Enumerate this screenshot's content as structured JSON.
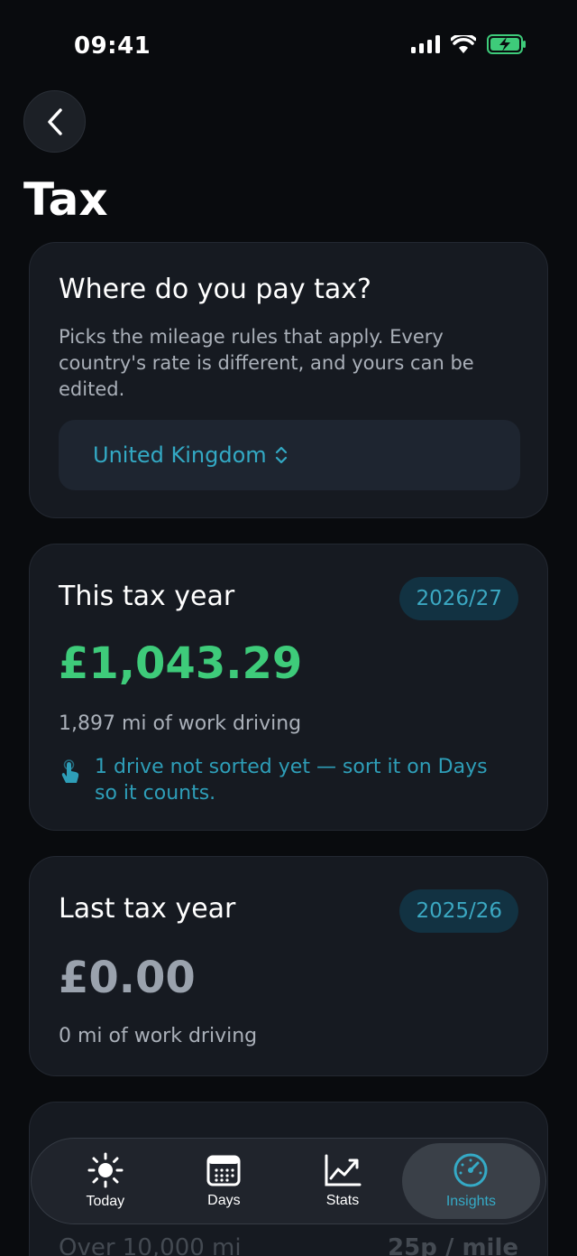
{
  "status": {
    "time": "09:41"
  },
  "page": {
    "title": "Tax"
  },
  "country_card": {
    "title": "Where do you pay tax?",
    "description": "Picks the mileage rules that apply. Every country's rate is different, and yours can be edited.",
    "selected_country": "United Kingdom"
  },
  "this_year": {
    "title": "This tax year",
    "badge": "2026/27",
    "amount": "£1,043.29",
    "miles": "1,897 mi of work driving",
    "notice": "1 drive not sorted yet — sort it on Days so it counts."
  },
  "last_year": {
    "title": "Last tax year",
    "badge": "2025/26",
    "amount": "£0.00",
    "miles": "0 mi of work driving"
  },
  "rates_card": {
    "band_label": "Over 10,000 mi",
    "band_rate": "25p / mile"
  },
  "tabs": [
    {
      "label": "Today",
      "icon": "sun-icon"
    },
    {
      "label": "Days",
      "icon": "calendar-icon"
    },
    {
      "label": "Stats",
      "icon": "chart-icon"
    },
    {
      "label": "Insights",
      "icon": "gauge-icon"
    }
  ],
  "colors": {
    "accent": "#33a9c4",
    "positive": "#3ecb7a",
    "battery": "#3ecb7a"
  }
}
